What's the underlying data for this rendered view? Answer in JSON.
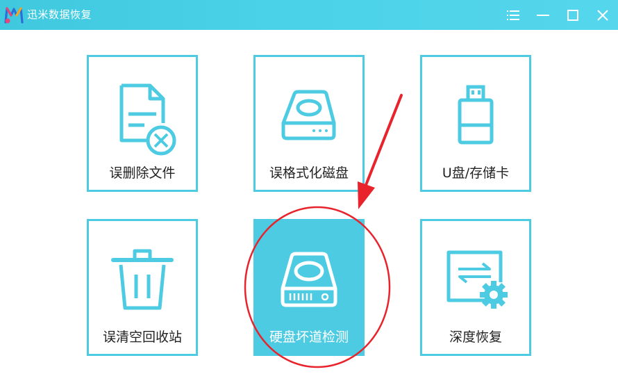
{
  "window": {
    "title": "迅米数据恢复",
    "controls": [
      "menu-icon",
      "minimize-icon",
      "maximize-icon",
      "close-icon"
    ]
  },
  "colors": {
    "accent": "#4ccbe2",
    "titlebar": "#4ad2e8",
    "annotation": "#e8232b"
  },
  "tiles": [
    {
      "label": "误删除文件",
      "icon": "deleted-file-icon",
      "active": false
    },
    {
      "label": "误格式化磁盘",
      "icon": "disk-icon",
      "active": false
    },
    {
      "label": "U盘/存储卡",
      "icon": "usb-drive-icon",
      "active": false
    },
    {
      "label": "误清空回收站",
      "icon": "trash-icon",
      "active": false
    },
    {
      "label": "硬盘坏道检测",
      "icon": "hard-drive-icon",
      "active": true
    },
    {
      "label": "深度恢复",
      "icon": "deep-recovery-icon",
      "active": false
    }
  ]
}
